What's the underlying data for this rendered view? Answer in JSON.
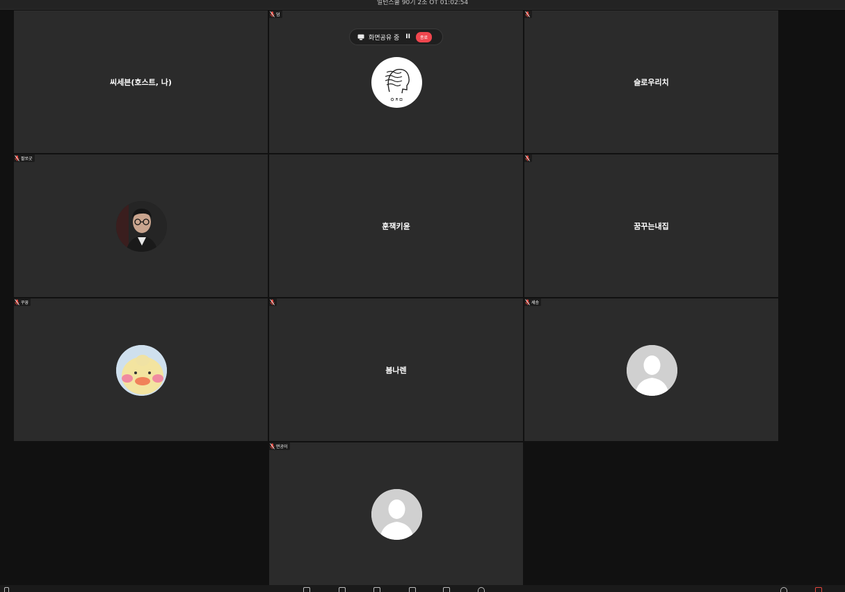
{
  "window": {
    "title": "밀턴스쿨 90기 2조 OT 01:02:54"
  },
  "share_bar": {
    "label": "화면공유 중",
    "pause": "II",
    "stop": "종료"
  },
  "participants": [
    {
      "name": "씨세븐(호스트, 나)",
      "tag": ""
    },
    {
      "name": "",
      "tag": "덤"
    },
    {
      "name": "슬로우리치",
      "tag": ""
    },
    {
      "name": "",
      "tag": "팔쏘굿"
    },
    {
      "name": "훈잭키윤",
      "tag": ""
    },
    {
      "name": "꿈꾸는내집",
      "tag": ""
    },
    {
      "name": "",
      "tag": "꾸꿍"
    },
    {
      "name": "봄나렌",
      "tag": ""
    },
    {
      "name": "",
      "tag": "세승"
    },
    {
      "name": "",
      "tag": "떤공이"
    }
  ],
  "colors": {
    "tile_bg": "#2b2b2b",
    "page_bg": "#111111",
    "mute_red": "#e8453c",
    "stop_red": "#f0464e"
  },
  "icons": {
    "mute": "mic-off-icon",
    "share": "screen-share-icon"
  }
}
